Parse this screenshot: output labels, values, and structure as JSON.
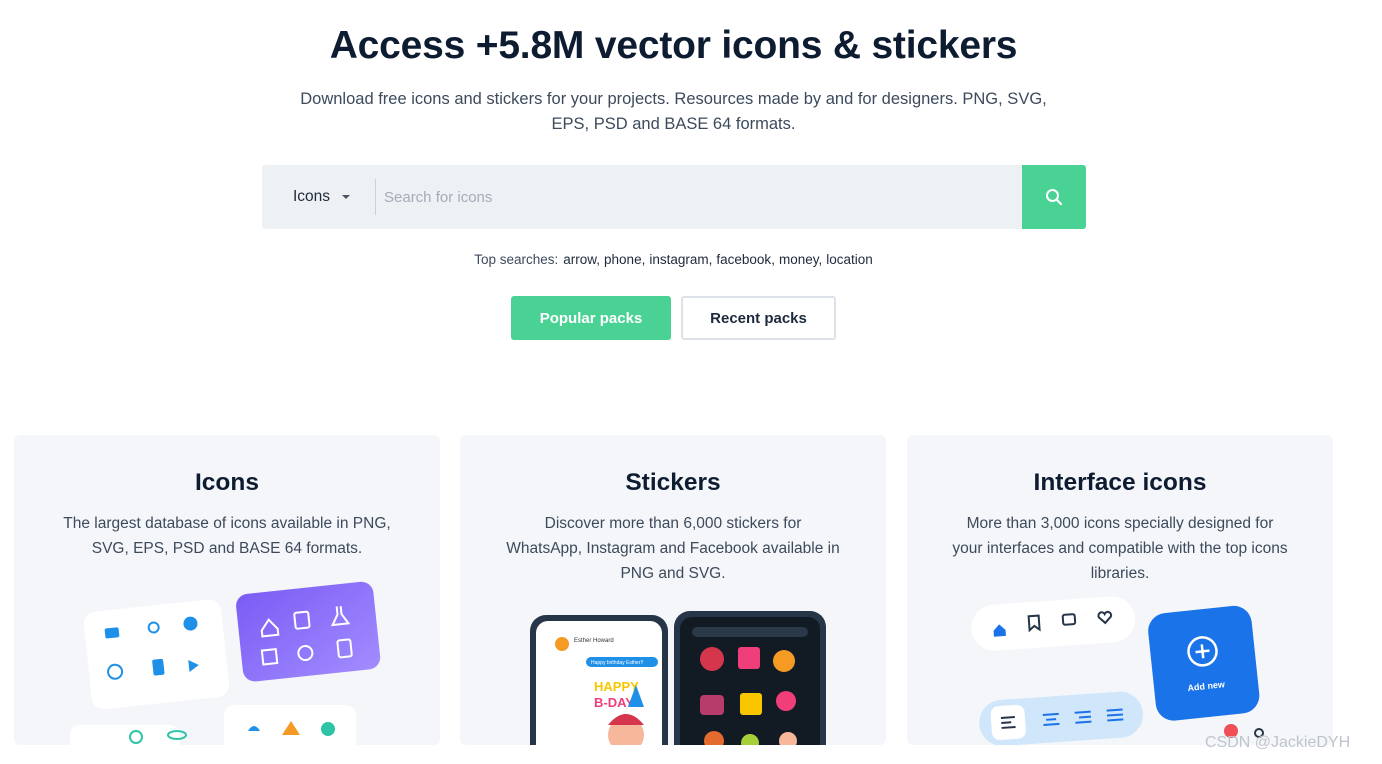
{
  "hero": {
    "title": "Access +5.8M vector icons & stickers",
    "subtitle": "Download free icons and stickers for your projects. Resources made by and for designers. PNG, SVG, EPS, PSD and BASE 64 formats."
  },
  "search": {
    "type_label": "Icons",
    "placeholder": "Search for icons",
    "button_icon": "search-icon"
  },
  "top_searches": {
    "label": "Top searches:",
    "items": [
      "arrow",
      "phone",
      "instagram",
      "facebook",
      "money",
      "location"
    ]
  },
  "buttons": {
    "popular": "Popular packs",
    "recent": "Recent packs"
  },
  "cards": [
    {
      "title": "Icons",
      "description": "The largest database of icons available in PNG, SVG, EPS, PSD and BASE 64 formats."
    },
    {
      "title": "Stickers",
      "description": "Discover more than 6,000 stickers for WhatsApp, Instagram and Facebook available in PNG and SVG.",
      "art": {
        "chat_name": "Esther Howard",
        "chat_msg": "Happy birthday Esther!!",
        "sticker_text_1": "HAPPY",
        "sticker_text_2": "B-DAY!"
      }
    },
    {
      "title": "Interface icons",
      "description": "More than 3,000 icons specially designed for your interfaces and compatible with the top icons libraries.",
      "art": {
        "add_label": "Add new"
      }
    }
  ],
  "watermark": "CSDN @JackieDYH",
  "colors": {
    "accent": "#4ad295",
    "title": "#0e1c32",
    "text": "#3d4a5c",
    "card_bg": "#f4f6f9",
    "blue": "#1a73e8"
  }
}
